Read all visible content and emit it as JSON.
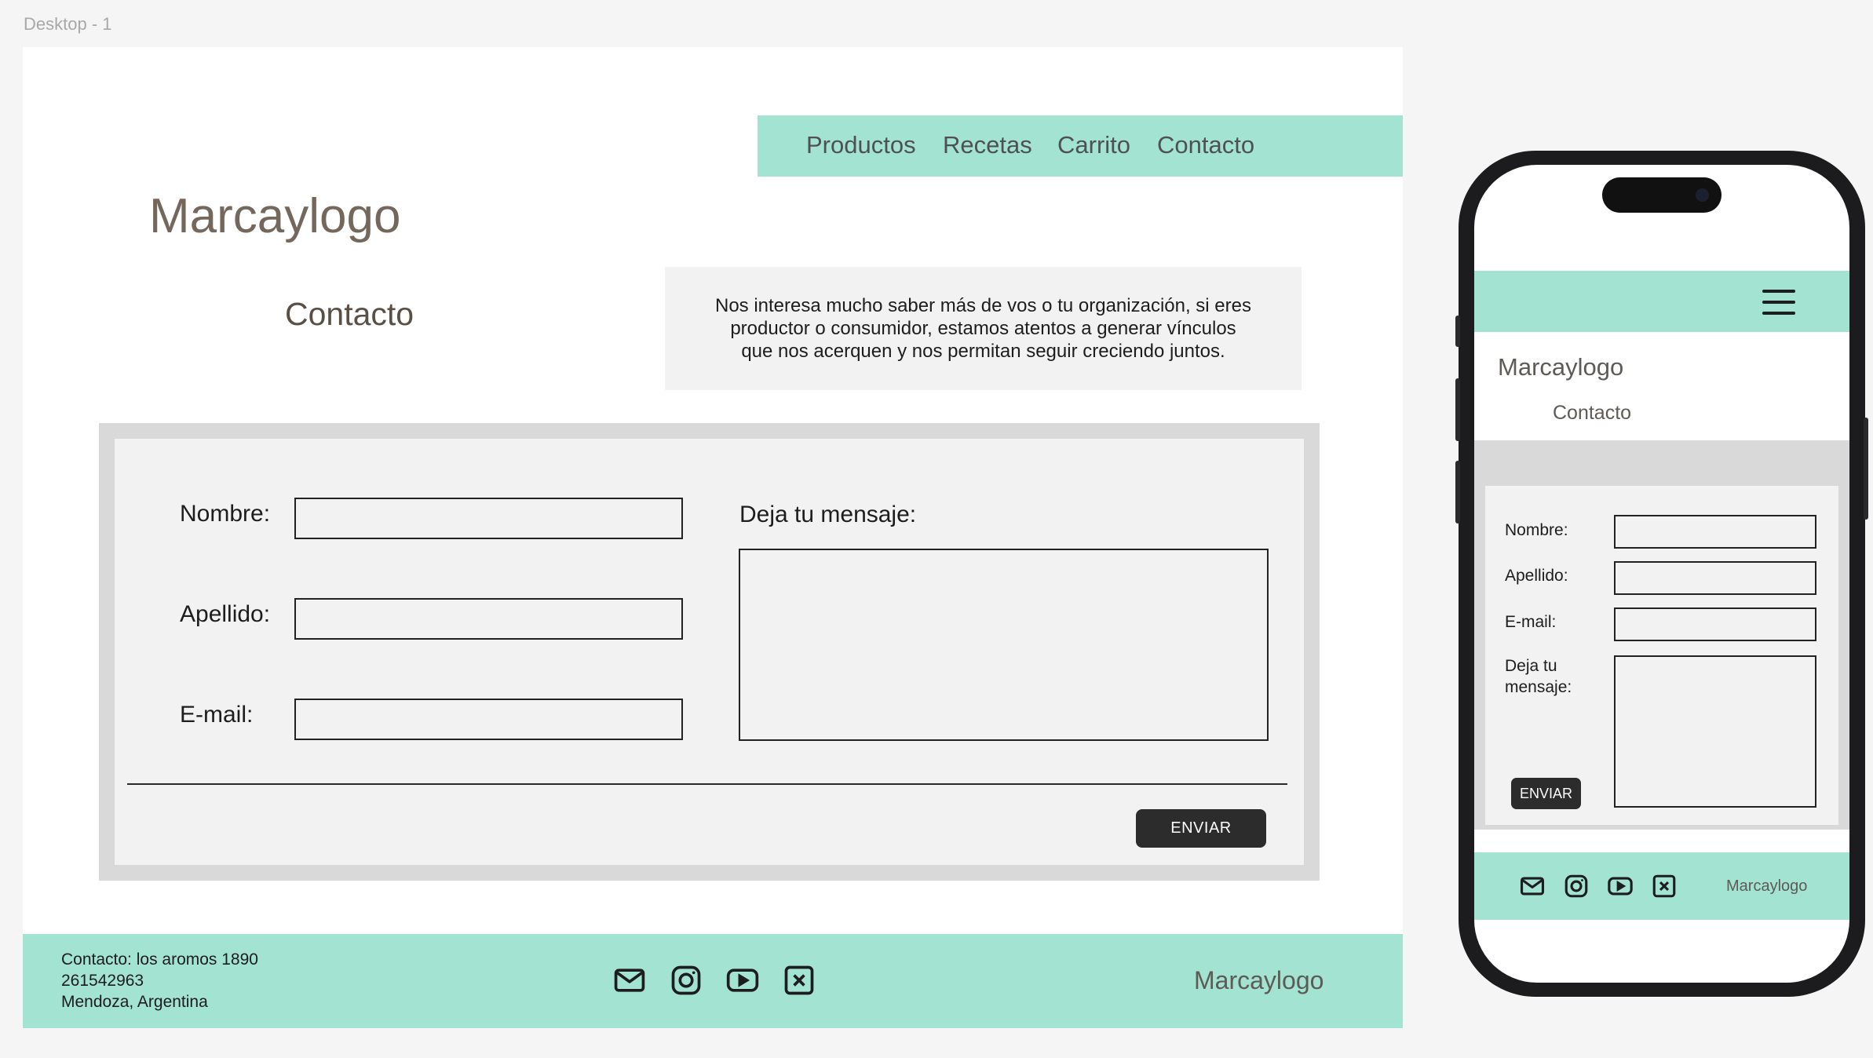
{
  "frame_label": "Desktop - 1",
  "nav": {
    "items": [
      {
        "label": "Productos"
      },
      {
        "label": "Recetas"
      },
      {
        "label": "Carrito"
      },
      {
        "label": "Contacto"
      }
    ]
  },
  "brand": "Marcaylogo",
  "section_title": "Contacto",
  "intro_text": "Nos interesa mucho saber más de vos o tu organización, si eres productor o consumidor, estamos atentos a generar vínculos que nos acerquen y nos permitan seguir creciendo juntos.",
  "form": {
    "name_label": "Nombre:",
    "name_value": "",
    "lastname_label": "Apellido:",
    "lastname_value": "",
    "email_label": "E-mail:",
    "email_value": "",
    "message_label": "Deja tu mensaje:",
    "message_value": "",
    "submit_label": "ENVIAR"
  },
  "footer": {
    "contact_lines": [
      "Contacto: los aromos 1890",
      "261542963",
      "Mendoza, Argentina"
    ],
    "icons": [
      "mail-icon",
      "instagram-icon",
      "youtube-icon",
      "x-icon"
    ],
    "brand": "Marcaylogo"
  },
  "mobile": {
    "menu_icon": "hamburger-menu-icon",
    "brand": "Marcaylogo",
    "section_title": "Contacto",
    "form": {
      "name_label": "Nombre:",
      "lastname_label": "Apellido:",
      "email_label": "E-mail:",
      "message_label": "Deja tu mensaje:",
      "submit_label": "ENVIAR"
    },
    "footer_brand": "Marcaylogo"
  },
  "colors": {
    "accent": "#a2e3d1",
    "form_border": "#d9d9d9",
    "form_bg": "#f2f2f2",
    "button": "#2c2c2c"
  }
}
